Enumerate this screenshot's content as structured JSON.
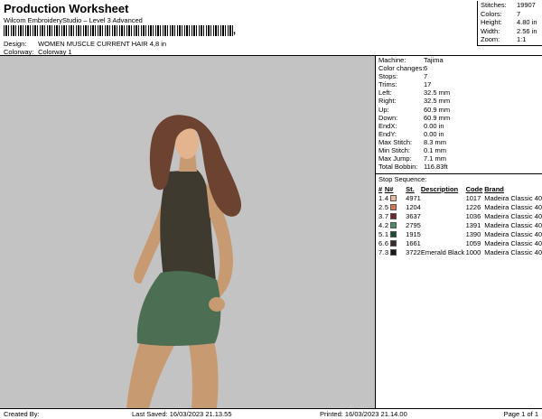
{
  "header": {
    "title": "Production Worksheet",
    "software": "Wilcom EmbroideryStudio – Level 3 Advanced",
    "barcode_tail": ",",
    "design_label": "Design:",
    "design_value": "WOMEN MUSCLE CURRENT HAIR 4,8 in",
    "colorway_label": "Colorway:",
    "colorway_value": "Colorway 1"
  },
  "stats": [
    {
      "label": "Stitches:",
      "value": "19907"
    },
    {
      "label": "Colors:",
      "value": "7"
    },
    {
      "label": "Height:",
      "value": "4.80 in"
    },
    {
      "label": "Width:",
      "value": "2.56 in"
    },
    {
      "label": "Zoom:",
      "value": "1:1"
    }
  ],
  "machine_info": [
    {
      "label": "Machine:",
      "value": "Tajima"
    },
    {
      "label": "Color changes:",
      "value": "6"
    },
    {
      "label": "Stops:",
      "value": "7"
    },
    {
      "label": "Trims:",
      "value": "17"
    },
    {
      "label": "Left:",
      "value": "32.5 mm"
    },
    {
      "label": "Right:",
      "value": "32.5 mm"
    },
    {
      "label": "Up:",
      "value": "60.9 mm"
    },
    {
      "label": "Down:",
      "value": "60.9 mm"
    },
    {
      "label": "EndX:",
      "value": "0.00 in"
    },
    {
      "label": "EndY:",
      "value": "0.00 in"
    },
    {
      "label": "Max Stitch:",
      "value": "8.3 mm"
    },
    {
      "label": "Min Stitch:",
      "value": "0.1 mm"
    },
    {
      "label": "Max Jump:",
      "value": "7.1 mm"
    },
    {
      "label": "Total Bobbin:",
      "value": "116.83ft"
    }
  ],
  "stop_sequence": {
    "title": "Stop Sequence:",
    "columns": [
      "#",
      "N#",
      "St.",
      "Description",
      "Code",
      "Brand"
    ],
    "rows": [
      {
        "n": "1.",
        "needle": "4",
        "color": "#e8b9a0",
        "st": "4971",
        "desc": "",
        "code": "1017",
        "brand": "Madeira Classic 40"
      },
      {
        "n": "2.",
        "needle": "5",
        "color": "#d07a50",
        "st": "1204",
        "desc": "",
        "code": "1226",
        "brand": "Madeira Classic 40"
      },
      {
        "n": "3.",
        "needle": "7",
        "color": "#6e2a2a",
        "st": "3637",
        "desc": "",
        "code": "1036",
        "brand": "Madeira Classic 40"
      },
      {
        "n": "4.",
        "needle": "2",
        "color": "#4f8a6a",
        "st": "2795",
        "desc": "",
        "code": "1391",
        "brand": "Madeira Classic 40"
      },
      {
        "n": "5.",
        "needle": "1",
        "color": "#1c4d34",
        "st": "1915",
        "desc": "",
        "code": "1390",
        "brand": "Madeira Classic 40"
      },
      {
        "n": "6.",
        "needle": "6",
        "color": "#3a2a2a",
        "st": "1661",
        "desc": "",
        "code": "1059",
        "brand": "Madeira Classic 40"
      },
      {
        "n": "7.",
        "needle": "3",
        "color": "#1a1a1a",
        "st": "3722",
        "desc": "Emerald Black",
        "code": "1000",
        "brand": "Madeira Classic 40"
      }
    ]
  },
  "footer": {
    "created_by": "Created By:",
    "last_saved": "Last Saved: 16/03/2023 21.13.55",
    "printed": "Printed: 16/03/2023 21.14.00",
    "page": "Page 1 of 1"
  }
}
